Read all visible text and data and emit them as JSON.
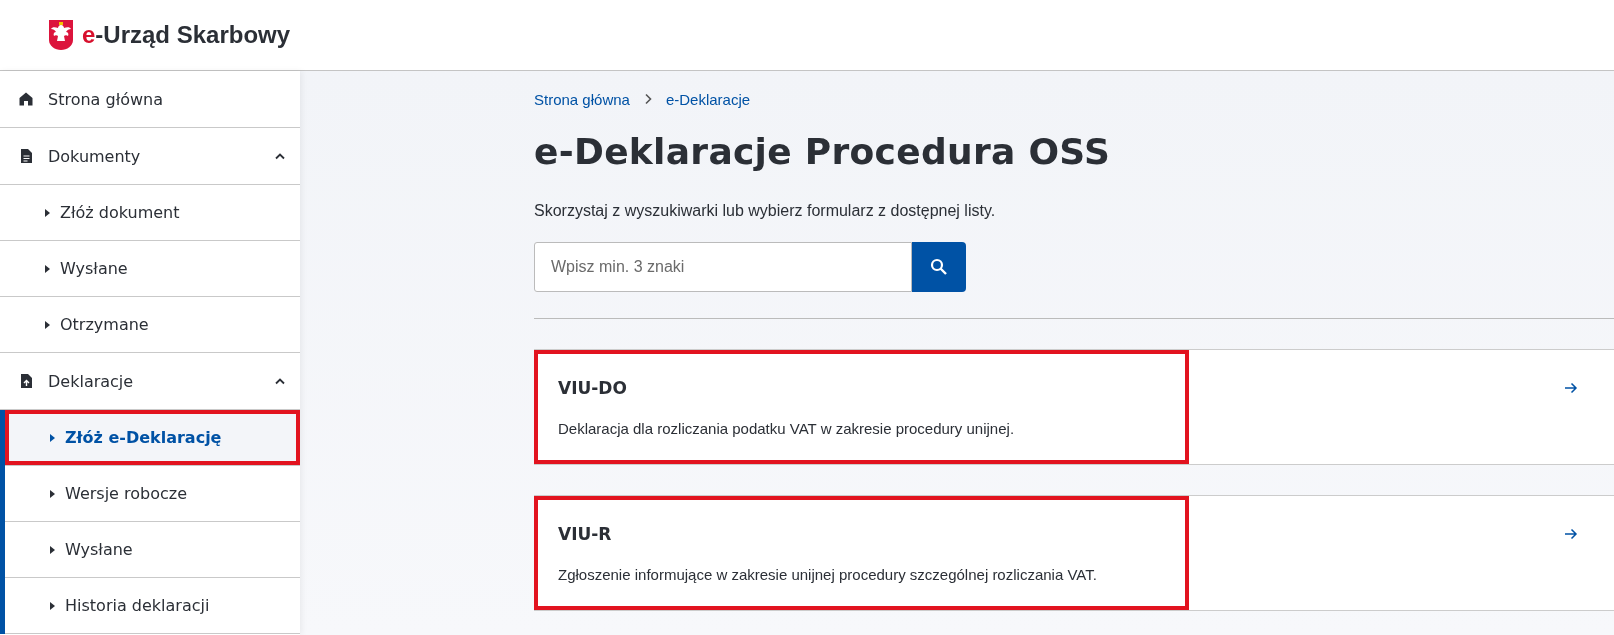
{
  "header": {
    "logo_prefix": "e",
    "logo_text": "-Urząd Skarbowy"
  },
  "sidebar": {
    "items": [
      {
        "label": "Strona główna",
        "kind": "home"
      },
      {
        "label": "Dokumenty",
        "kind": "document",
        "expanded": true,
        "children": [
          {
            "label": "Złóż dokument",
            "selected": false,
            "highlighted": false
          },
          {
            "label": "Wysłane",
            "selected": false,
            "highlighted": false
          },
          {
            "label": "Otrzymane",
            "selected": false,
            "highlighted": false
          }
        ]
      },
      {
        "label": "Deklaracje",
        "kind": "upload",
        "expanded": true,
        "children": [
          {
            "label": "Złóż e-Deklarację",
            "selected": true,
            "highlighted": true
          },
          {
            "label": "Wersje robocze",
            "selected": false,
            "highlighted": false
          },
          {
            "label": "Wysłane",
            "selected": false,
            "highlighted": false
          },
          {
            "label": "Historia deklaracji",
            "selected": false,
            "highlighted": false
          }
        ]
      }
    ]
  },
  "breadcrumbs": [
    "Strona główna",
    "e-Deklaracje"
  ],
  "title": "e-Deklaracje Procedura OSS",
  "intro": "Skorzystaj z wyszukiwarki lub wybierz formularz z dostępnej listy.",
  "search": {
    "placeholder": "Wpisz min. 3 znaki"
  },
  "forms": [
    {
      "code": "VIU-DO",
      "description": "Deklaracja dla rozliczania podatku VAT w zakresie procedury unijnej.",
      "highlighted": true
    },
    {
      "code": "VIU-R",
      "description": "Zgłoszenie informujące w zakresie unijnej procedury szczególnej rozliczania VAT.",
      "highlighted": true
    }
  ]
}
